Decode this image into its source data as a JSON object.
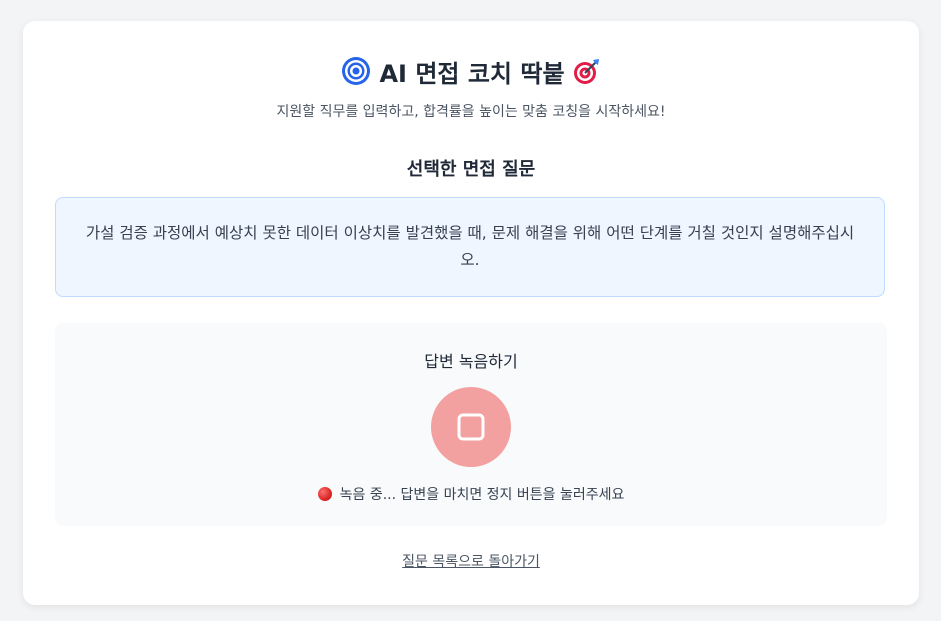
{
  "header": {
    "title": "AI 면접 코치 딱붙",
    "title_icon_left": "target-icon",
    "title_icon_right": "dart-icon",
    "subtitle": "지원할 직무를 입력하고, 합격률을 높이는 맞춤 코칭을 시작하세요!"
  },
  "question_section": {
    "title": "선택한 면접 질문",
    "question": "가설 검증 과정에서 예상치 못한 데이터 이상치를 발견했을 때, 문제 해결을 위해 어떤 단계를 거칠 것인지 설명해주십시오."
  },
  "recording": {
    "title": "답변 녹음하기",
    "button_icon": "stop-icon",
    "status_icon": "red-circle-icon",
    "status_text": "녹음 중... 답변을 마치면 정지 버튼을 눌러주세요"
  },
  "footer": {
    "back_link": "질문 목록으로 돌아가기"
  },
  "colors": {
    "accent_blue": "#2563eb",
    "question_bg": "#eff6ff",
    "question_border": "#bfdbfe",
    "record_button": "#f3a0a0",
    "status_red": "#dc2626"
  }
}
